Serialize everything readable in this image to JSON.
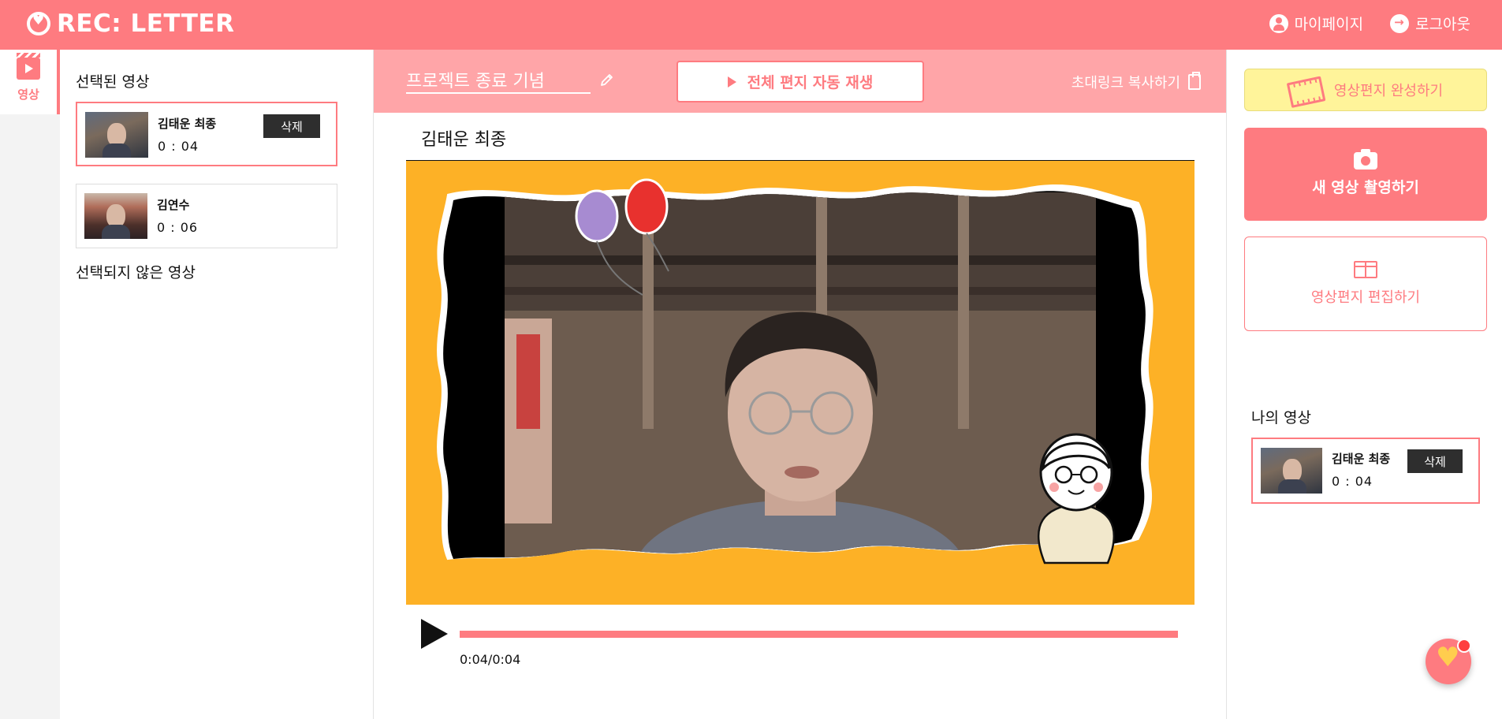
{
  "header": {
    "logo_text": "REC: LETTER",
    "mypage_label": "마이페이지",
    "logout_label": "로그아웃"
  },
  "rail": {
    "tab_label": "영상"
  },
  "left_panel": {
    "selected_title": "선택된 영상",
    "selected_clips": [
      {
        "name": "김태운 최종",
        "duration": "0 : 04",
        "delete_label": "삭제"
      },
      {
        "name": "김연수",
        "duration": "0 : 06"
      }
    ],
    "unselected_title": "선택되지 않은 영상"
  },
  "center": {
    "project_title": "프로젝트 종료 기념",
    "autoplay_label": "전체 편지 자동 재생",
    "invite_label": "초대링크 복사하기",
    "video_title": "김태운 최종",
    "time_readout": "0:04/0:04",
    "progress": 1.0
  },
  "right_panel": {
    "complete_label": "영상편지 완성하기",
    "new_video_label": "새 영상 촬영하기",
    "edit_label": "영상편지 편집하기",
    "my_videos_title": "나의 영상",
    "my_clip": {
      "name": "김태운 최종",
      "duration": "0 : 04",
      "delete_label": "삭제"
    }
  },
  "colors": {
    "brand": "#fe7b80",
    "brand_light": "#ffa5a8",
    "frame_bg": "#fdb126",
    "complete_button": "#fff49a"
  }
}
